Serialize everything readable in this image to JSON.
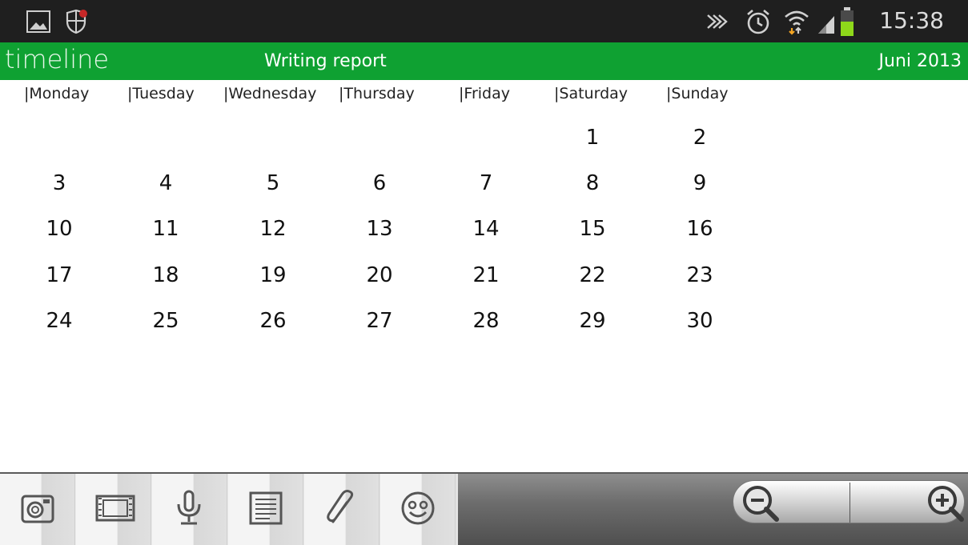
{
  "status_bar": {
    "time": "15:38",
    "left_icons": [
      "image-icon",
      "shield-icon"
    ],
    "right_icons": [
      "nfc-icon",
      "alarm-icon",
      "wifi-icon",
      "signal-icon",
      "battery-icon"
    ]
  },
  "header": {
    "logo": "timeline",
    "title": "Writing report",
    "month": "Juni 2013",
    "bg_color": "#0fa132"
  },
  "weekdays": [
    "|Monday",
    "|Tuesday",
    "|Wednesday",
    "|Thursday",
    "|Friday",
    "|Saturday",
    "|Sunday"
  ],
  "calendar": {
    "weeks": [
      [
        "",
        "",
        "",
        "",
        "",
        "1",
        "2"
      ],
      [
        "3",
        "4",
        "5",
        "6",
        "7",
        "8",
        "9"
      ],
      [
        "10",
        "11",
        "12",
        "13",
        "14",
        "15",
        "16"
      ],
      [
        "17",
        "18",
        "19",
        "20",
        "21",
        "22",
        "23"
      ],
      [
        "24",
        "25",
        "26",
        "27",
        "28",
        "29",
        "30"
      ]
    ]
  },
  "toolbar": {
    "tools": [
      "camera-icon",
      "film-icon",
      "microphone-icon",
      "text-note-icon",
      "paperclip-icon",
      "smiley-icon"
    ],
    "zoom_out": "zoom-out-icon",
    "zoom_in": "zoom-in-icon"
  }
}
